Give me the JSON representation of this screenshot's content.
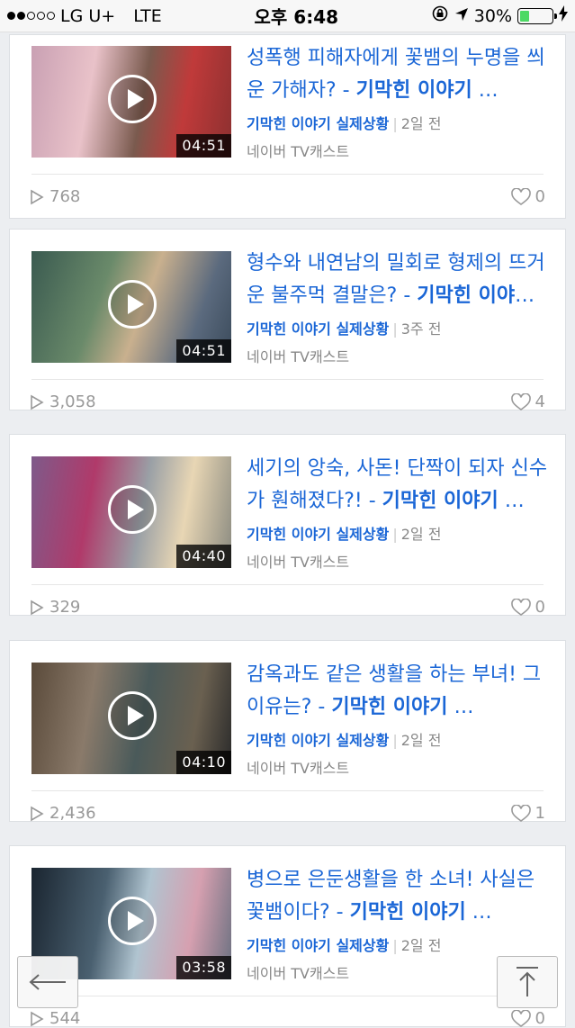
{
  "status_bar": {
    "carrier": "LG U+",
    "network": "LTE",
    "time": "오후 6:48",
    "battery": "30%",
    "battery_level": 0.3,
    "signal_bars": 2
  },
  "videos": [
    {
      "title": "성폭행 피해자에게 꽃뱀의 누명을 씌운 가해자?",
      "title_suffix": "기막힌 이야기",
      "channel": "기막힌 이야기 실제상황",
      "age": "2일 전",
      "source": "네이버 TV캐스트",
      "duration": "04:51",
      "views": "768",
      "likes": "0"
    },
    {
      "title": "형수와 내연남의 밀회로 형제의 뜨거운 불주먹 결말은?",
      "title_suffix": "기막힌 이야기",
      "channel": "기막힌 이야기 실제상황",
      "age": "3주 전",
      "source": "네이버 TV캐스트",
      "duration": "04:51",
      "views": "3,058",
      "likes": "4"
    },
    {
      "title": "세기의 앙숙, 사돈! 단짝이 되자 신수가 훤해졌다?!",
      "title_suffix": "기막힌 이야기",
      "channel": "기막힌 이야기 실제상황",
      "age": "2일 전",
      "source": "네이버 TV캐스트",
      "duration": "04:40",
      "views": "329",
      "likes": "0"
    },
    {
      "title": "감옥과도 같은 생활을 하는 부녀! 그 이유는?",
      "title_suffix": "기막힌 이야기",
      "channel": "기막힌 이야기 실제상황",
      "age": "2일 전",
      "source": "네이버 TV캐스트",
      "duration": "04:10",
      "views": "2,436",
      "likes": "1"
    },
    {
      "title": "병으로 은둔생활을 한 소녀! 사실은 꽃뱀이다?",
      "title_suffix": "기막힌 이야기",
      "channel": "기막힌 이야기 실제상황",
      "age": "2일 전",
      "source": "네이버 TV캐스트",
      "duration": "03:58",
      "views": "544",
      "likes": "0"
    }
  ],
  "colors": {
    "link_blue": "#1a66d6",
    "meta_gray": "#888888",
    "battery_green": "#4cd964"
  },
  "icons": [
    "lock-rotation-icon",
    "location-arrow-icon",
    "charging-bolt-icon",
    "play-icon",
    "views-play-icon",
    "heart-icon",
    "back-arrow-icon",
    "scroll-top-icon"
  ]
}
